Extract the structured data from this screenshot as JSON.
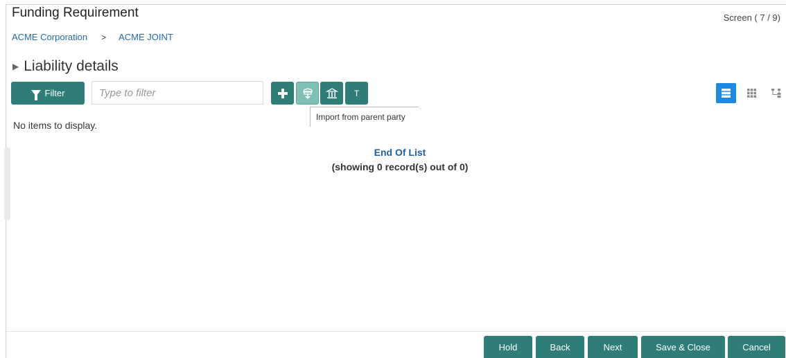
{
  "header": {
    "title": "Funding Requirement",
    "screen_indicator": "Screen ( 7 / 9)"
  },
  "breadcrumb": {
    "items": [
      "ACME Corporation",
      "ACME JOINT"
    ],
    "separator": ">"
  },
  "section": {
    "title": "Liability details"
  },
  "toolbar": {
    "filter_label": "Filter",
    "filter_placeholder": "Type to filter",
    "t_label": "T",
    "tooltip": "Import from parent party"
  },
  "list": {
    "empty_message": "No items to display.",
    "end_title": "End Of List",
    "end_count": "(showing 0 record(s) out of 0)"
  },
  "footer": {
    "hold": "Hold",
    "back": "Back",
    "next": "Next",
    "save_close": "Save & Close",
    "cancel": "Cancel"
  },
  "colors": {
    "primary": "#2e7d77",
    "primary_light": "#7ec0b6",
    "link": "#1f6aa5",
    "view_active": "#1e88e5"
  },
  "icons": [
    "funnel-icon",
    "plus-icon",
    "import-icon",
    "bank-icon",
    "list-view-icon",
    "grid-view-icon",
    "tree-view-icon",
    "caret-right-icon"
  ]
}
